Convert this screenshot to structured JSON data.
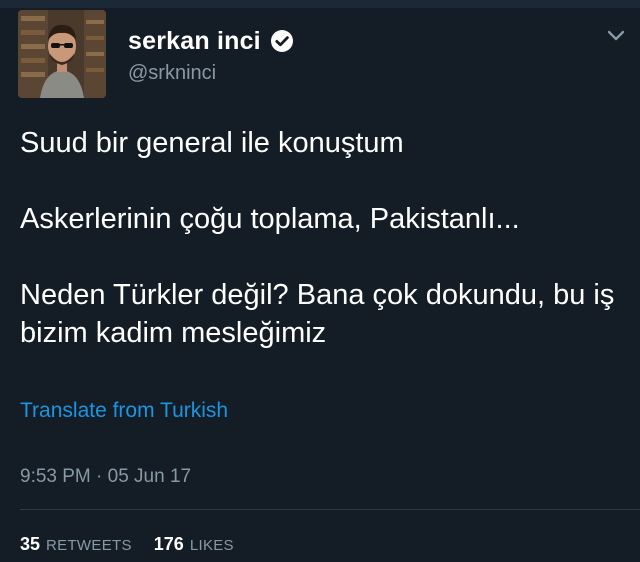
{
  "author": {
    "display_name": "serkan inci",
    "handle": "@srkninci",
    "verified_icon": "verified-badge-icon",
    "avatar_icon": "user-avatar"
  },
  "menu": {
    "icon": "chevron-down-icon"
  },
  "tweet": {
    "paragraphs": [
      "Suud bir general ile konuştum",
      "Askerlerinin çoğu toplama, Pakistanlı...",
      "Neden Türkler değil? Bana çok dokundu, bu iş bizim kadim mesleğimiz"
    ],
    "translate_label": "Translate from Turkish",
    "timestamp": "9:53 PM · 05 Jun 17"
  },
  "stats": {
    "retweets_count": "35",
    "retweets_label": "RETWEETS",
    "likes_count": "176",
    "likes_label": "LIKES"
  },
  "colors": {
    "background": "#141d26",
    "text": "#ffffff",
    "muted": "#8899a6",
    "link": "#1b95e0"
  }
}
